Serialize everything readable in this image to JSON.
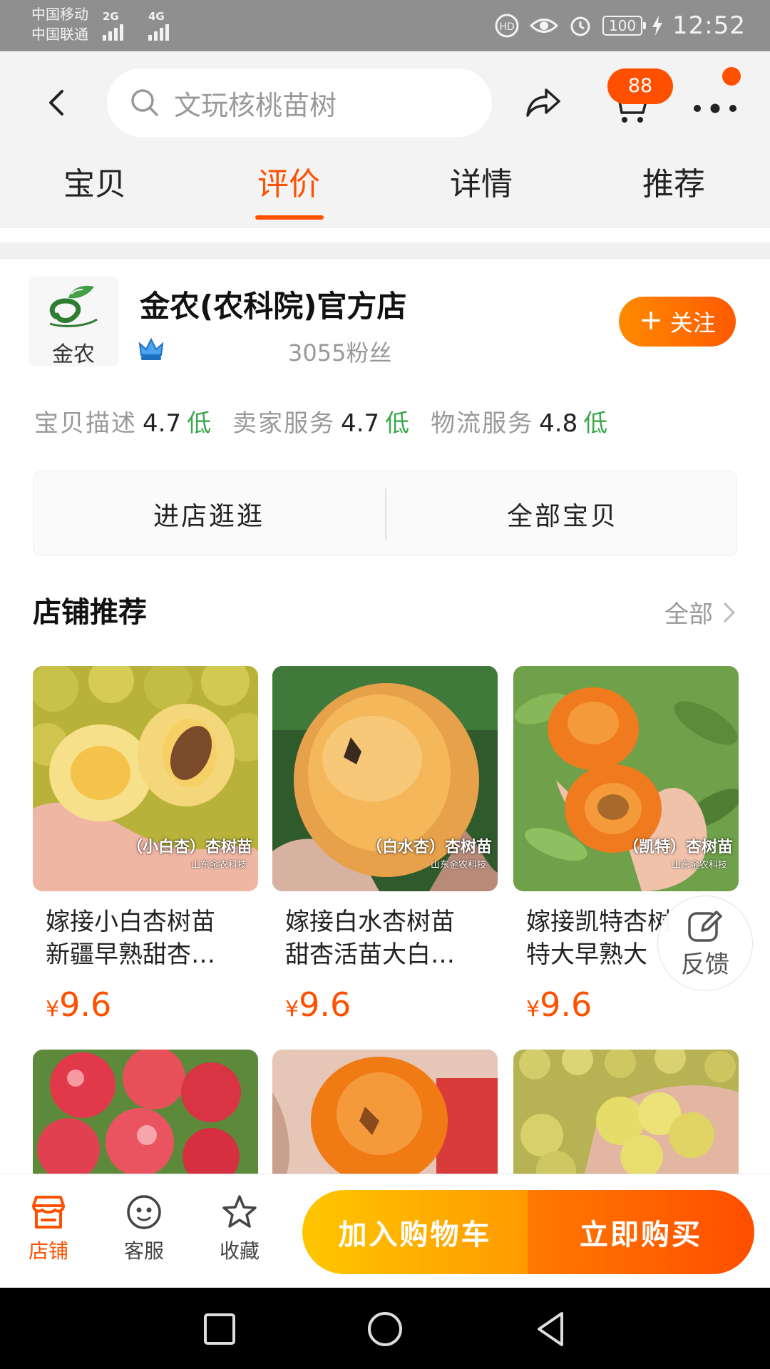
{
  "status_bar": {
    "carrier_1": "中国移动",
    "carrier_2": "中国联通",
    "network_1": "2G",
    "network_2": "4G",
    "battery": "100",
    "time": "12:52"
  },
  "header": {
    "search_placeholder": "文玩核桃苗树",
    "cart_badge": "88",
    "tabs": [
      {
        "label": "宝贝"
      },
      {
        "label": "评价",
        "active": true
      },
      {
        "label": "详情"
      },
      {
        "label": "推荐"
      }
    ]
  },
  "shop": {
    "logo_text": "金农",
    "name": "金农(农科院)官方店",
    "fans": "3055粉丝",
    "follow_label": "关注",
    "ratings": [
      {
        "label": "宝贝描述",
        "value": "4.7",
        "level": "低"
      },
      {
        "label": "卖家服务",
        "value": "4.7",
        "level": "低"
      },
      {
        "label": "物流服务",
        "value": "4.8",
        "level": "低"
      }
    ],
    "enter_store": "进店逛逛",
    "all_items": "全部宝贝"
  },
  "recommend": {
    "title": "店铺推荐",
    "more": "全部",
    "products": [
      {
        "caption": "（小白杏）杏树苗",
        "caption_sub": "山东金农科技",
        "title_line1": "嫁接小白杏树苗",
        "title_line2": "新疆早熟甜杏…",
        "currency": "¥",
        "price": "9.6"
      },
      {
        "caption": "（白水杏）杏树苗",
        "caption_sub": "山东金农科技",
        "title_line1": "嫁接白水杏树苗",
        "title_line2": "甜杏活苗大白…",
        "currency": "¥",
        "price": "9.6"
      },
      {
        "caption": "（凯特）杏树苗",
        "caption_sub": "山东金农科技",
        "title_line1": "嫁接凯特杏树",
        "title_line2": "特大早熟大",
        "currency": "¥",
        "price": "9.6"
      }
    ]
  },
  "feedback_label": "反馈",
  "bottom_bar": {
    "store": "店铺",
    "service": "客服",
    "favorite": "收藏",
    "add_to_cart": "加入购物车",
    "buy_now": "立即购买"
  },
  "colors": {
    "accent": "#ff5000",
    "rating_low": "#3aa84a",
    "cart_gradient_start": "#ffc600",
    "buy_gradient_end": "#ff4e00"
  }
}
